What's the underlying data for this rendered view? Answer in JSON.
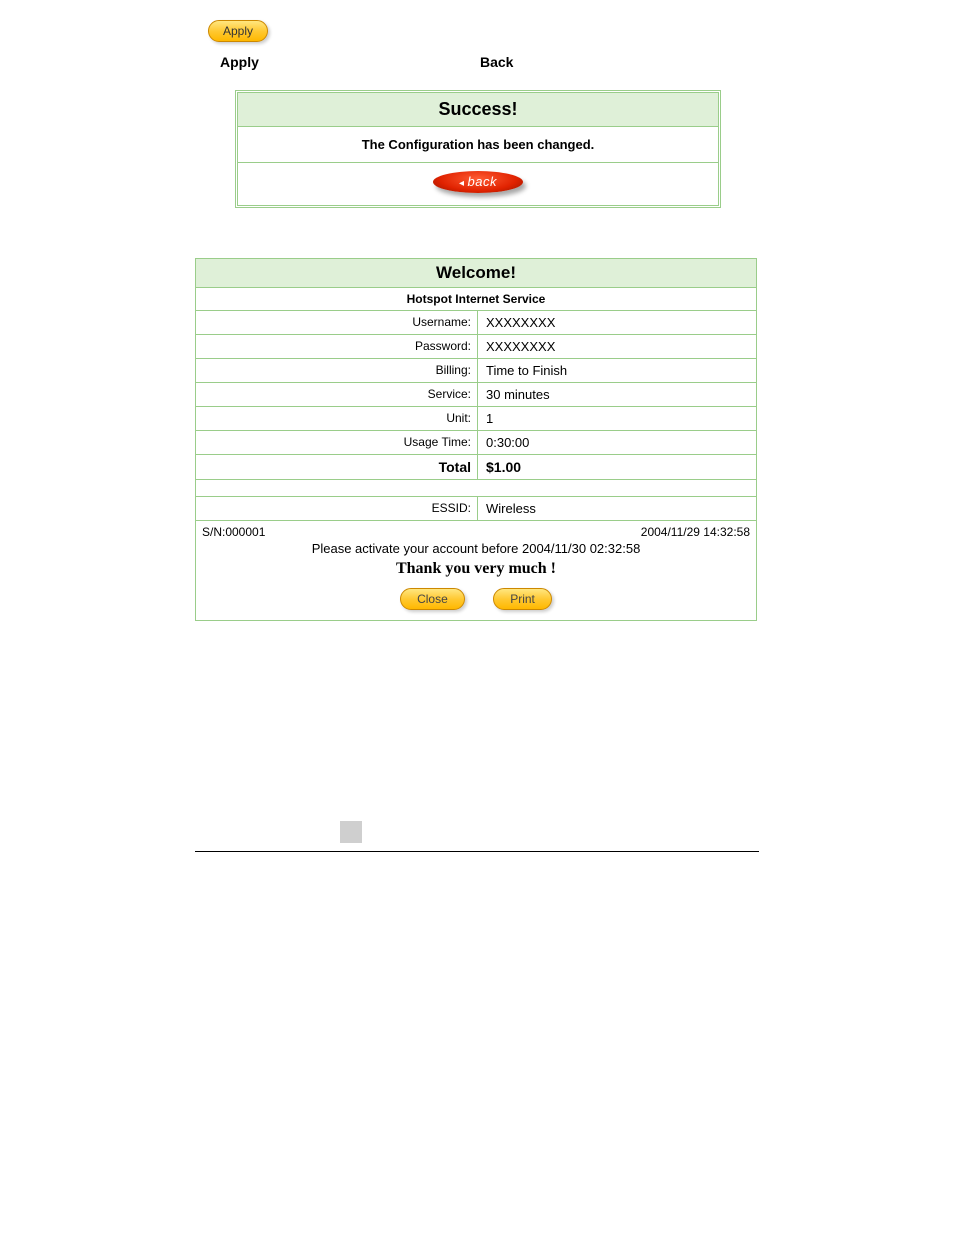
{
  "top": {
    "apply_button": "Apply",
    "label_apply": "Apply",
    "label_back": "Back"
  },
  "success_box": {
    "title": "Success!",
    "message": "The Configuration has been changed.",
    "back_label": "back"
  },
  "welcome_box": {
    "title": "Welcome!",
    "subtitle": "Hotspot Internet Service",
    "rows": {
      "username_label": "Username:",
      "username_value": "XXXXXXXX",
      "password_label": "Password:",
      "password_value": "XXXXXXXX",
      "billing_label": "Billing:",
      "billing_value": "Time to Finish",
      "service_label": "Service:",
      "service_value": "30 minutes",
      "unit_label": "Unit:",
      "unit_value": "1",
      "usage_label": "Usage Time:",
      "usage_value": "0:30:00",
      "total_label": "Total",
      "total_value": "$1.00",
      "essid_label": "ESSID:",
      "essid_value": "Wireless"
    },
    "footer": {
      "sn": "S/N:000001",
      "timestamp": "2004/11/29 14:32:58",
      "activate": "Please activate your account before  2004/11/30 02:32:58",
      "thanks": "Thank you very much !",
      "close_label": "Close",
      "print_label": "Print"
    }
  }
}
